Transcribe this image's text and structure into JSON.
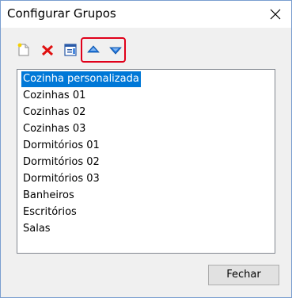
{
  "window": {
    "title": "Configurar Grupos"
  },
  "toolbar": {
    "buttons": [
      {
        "icon": "new-document-icon"
      },
      {
        "icon": "delete-icon"
      },
      {
        "icon": "edit-icon"
      },
      {
        "icon": "move-up-icon"
      },
      {
        "icon": "move-down-icon"
      }
    ]
  },
  "groups": {
    "items": [
      "Cozinha personalizada",
      "Cozinhas 01",
      "Cozinhas 02",
      "Cozinhas 03",
      "Dormitórios 01",
      "Dormitórios 02",
      "Dormitórios 03",
      "Banheiros",
      "Escritórios",
      "Salas"
    ],
    "selected": "Cozinha personalizada"
  },
  "footer": {
    "close_label": "Fechar"
  },
  "colors": {
    "selection": "#0078d7",
    "highlight_box": "#e0001a",
    "arrow_blue": "#1e73d8"
  }
}
